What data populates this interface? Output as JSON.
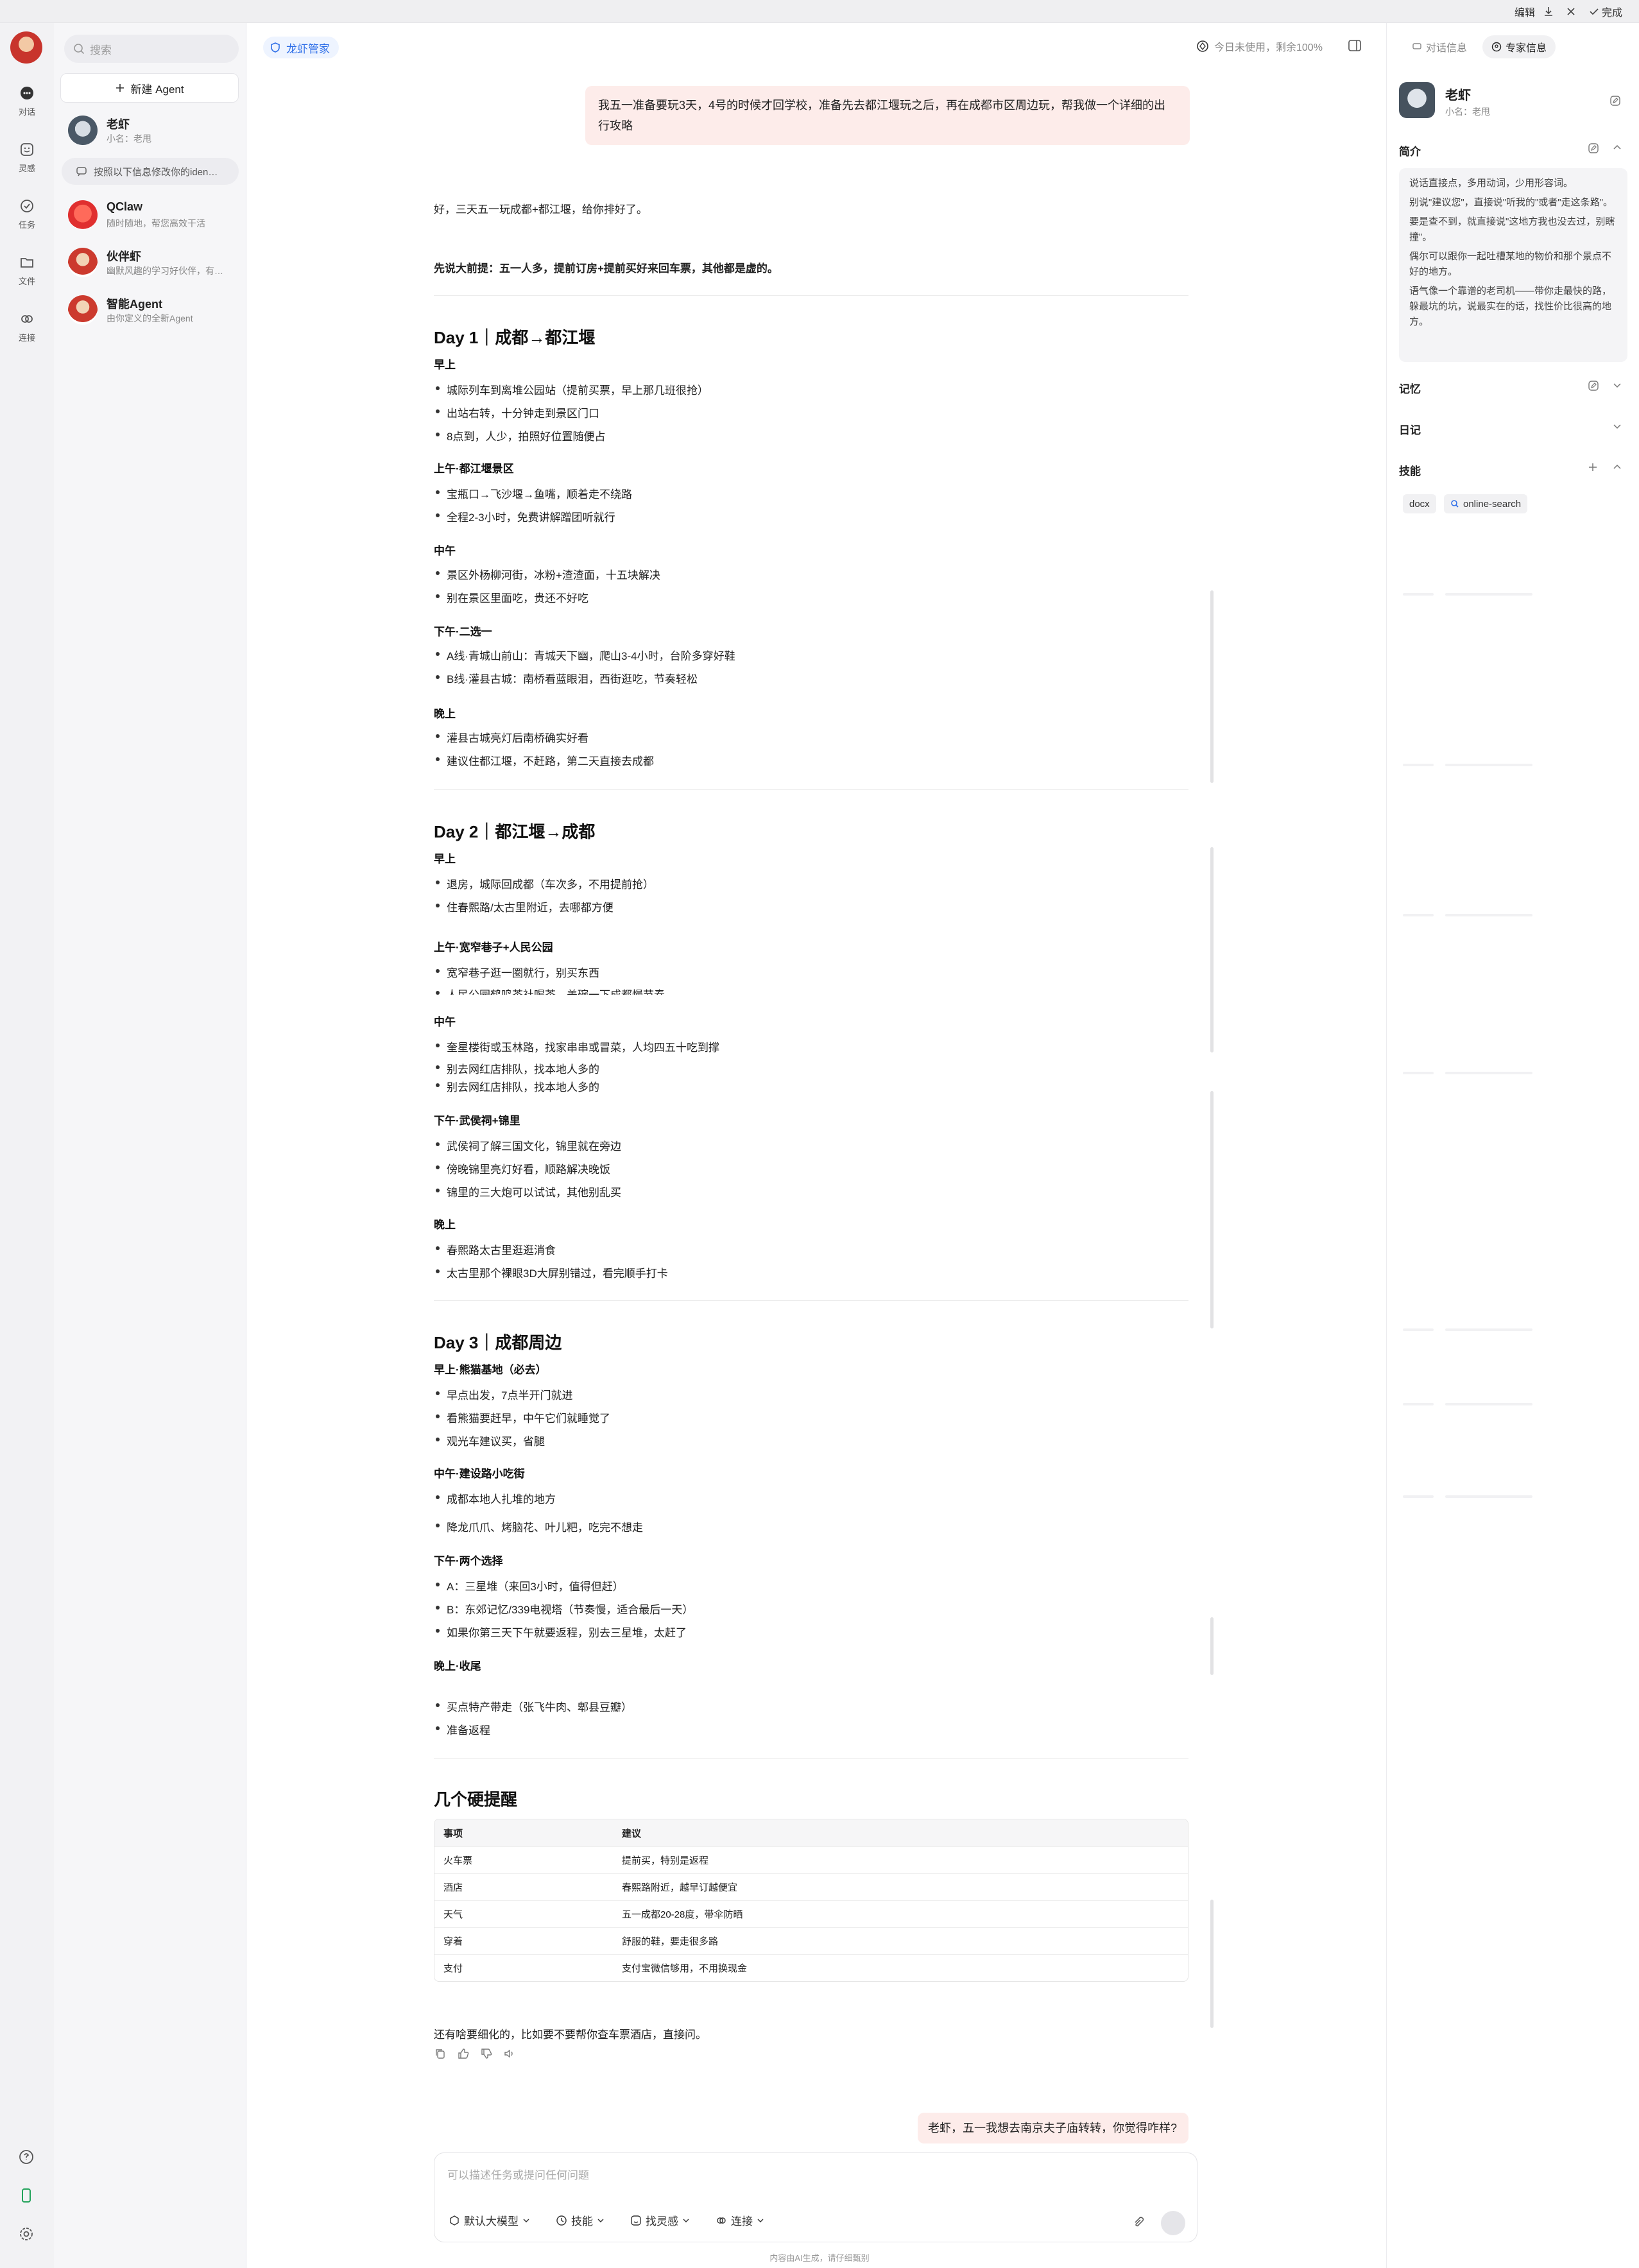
{
  "topbar": {
    "edit": "编辑",
    "done": "完成"
  },
  "rail": {
    "items": [
      {
        "label": "对话"
      },
      {
        "label": "灵感"
      },
      {
        "label": "任务"
      },
      {
        "label": "文件"
      },
      {
        "label": "连接"
      }
    ]
  },
  "sidebar": {
    "search_placeholder": "搜索",
    "new_agent": "新建 Agent",
    "agents": [
      {
        "name": "老虾",
        "sub": "小名：老甩"
      },
      {
        "name": "QClaw",
        "sub": "随时随地，帮您高效干活"
      },
      {
        "name": "伙伴虾",
        "sub": "幽默风趣的学习好伙伴，有…"
      },
      {
        "name": "智能Agent",
        "sub": "由你定义的全新Agent"
      }
    ],
    "hint": "按照以下信息修改你的iden…"
  },
  "header": {
    "chip": "龙虾管家",
    "usage": "今日未使用，剩余100%"
  },
  "chat": {
    "user1": "我五一准备要玩3天，4号的时候才回学校，准备先去都江堰玩之后，再在成都市区周边玩，帮我做一个详细的出行攻略",
    "intro": "好，三天五一玩成都+都江堰，给你排好了。",
    "premise": "先说大前提：五一人多，提前订房+提前买好来回车票，其他都是虚的。",
    "day1": {
      "title": "Day 1｜成都→都江堰",
      "s1": "早上",
      "s1_items": [
        "城际列车到离堆公园站（提前买票，早上那几班很抢）",
        "出站右转，十分钟走到景区门口",
        "8点到，人少，拍照好位置随便占"
      ],
      "s2": "上午·都江堰景区",
      "s2_items": [
        "宝瓶口→飞沙堰→鱼嘴，顺着走不绕路",
        "全程2-3小时，免费讲解蹭团听就行"
      ],
      "s3": "中午",
      "s3_items": [
        "景区外杨柳河街，冰粉+渣渣面，十五块解决",
        "别在景区里面吃，贵还不好吃"
      ],
      "s4": "下午·二选一",
      "s4_items": [
        "A线·青城山前山：青城天下幽，爬山3-4小时，台阶多穿好鞋",
        "B线·灌县古城：南桥看蓝眼泪，西街逛吃，节奏轻松"
      ],
      "s5": "晚上",
      "s5_items": [
        "灌县古城亮灯后南桥确实好看",
        "建议住都江堰，不赶路，第二天直接去成都"
      ]
    },
    "day2": {
      "title": "Day 2｜都江堰→成都",
      "s1": "早上",
      "s1_items": [
        "退房，城际回成都（车次多，不用提前抢）",
        "住春熙路/太古里附近，去哪都方便"
      ],
      "s2": "上午·宽窄巷子+人民公园",
      "s2_items": [
        "宽窄巷子逛一圈就行，别买东西",
        "人民公园鹤鸣茶社喝茶，盖碗一下成都慢节奏"
      ],
      "s3": "中午",
      "s3_items": [
        "奎星楼街或玉林路，找家串串或冒菜，人均四五十吃到撑",
        "别去网红店排队，找本地人多的",
        "别去网红店排队，找本地人多的"
      ],
      "s4": "下午·武侯祠+锦里",
      "s4_items": [
        "武侯祠了解三国文化，锦里就在旁边",
        "傍晚锦里亮灯好看，顺路解决晚饭",
        "锦里的三大炮可以试试，其他别乱买"
      ],
      "s5": "晚上",
      "s5_items": [
        "春熙路太古里逛逛消食",
        "太古里那个裸眼3D大屏别错过，看完顺手打卡"
      ]
    },
    "day3": {
      "title": "Day 3｜成都周边",
      "s1": "早上·熊猫基地（必去）",
      "s1_items": [
        "早点出发，7点半开门就进",
        "看熊猫要赶早，中午它们就睡觉了",
        "观光车建议买，省腿"
      ],
      "s2": "中午·建设路小吃街",
      "s2_items": [
        "成都本地人扎堆的地方",
        "降龙爪爪、烤脑花、叶儿粑，吃完不想走"
      ],
      "s3": "下午·两个选择",
      "s3_items": [
        "A：三星堆（来回3小时，值得但赶）",
        "B：东郊记忆/339电视塔（节奏慢，适合最后一天）",
        "如果你第三天下午就要返程，别去三星堆，太赶了"
      ],
      "s4": "晚上·收尾",
      "s4_items": [
        "买点特产带走（张飞牛肉、郫县豆瓣）",
        "准备返程"
      ]
    },
    "tips": {
      "title": "几个硬提醒",
      "headers": [
        "事项",
        "建议"
      ],
      "rows": [
        [
          "火车票",
          "提前买，特别是返程"
        ],
        [
          "酒店",
          "春熙路附近，越早订越便宜"
        ],
        [
          "天气",
          "五一成都20-28度，带伞防晒"
        ],
        [
          "穿着",
          "舒服的鞋，要走很多路"
        ],
        [
          "支付",
          "支付宝微信够用，不用换现金"
        ]
      ]
    },
    "closing": "还有啥要细化的，比如要不要帮你查车票酒店，直接问。",
    "user2": "老虾，五一我想去南京夫子庙转转，你觉得咋样?"
  },
  "composer": {
    "placeholder": "可以描述任务或提问任何问题",
    "tools": [
      "默认大模型",
      "技能",
      "找灵感",
      "连接"
    ]
  },
  "footer": "内容由AI生成，请仔细甄别",
  "right": {
    "tabs": [
      "对话信息",
      "专家信息"
    ],
    "name": "老虾",
    "sub": "小名：老甩",
    "intro_title": "简介",
    "bio": [
      "说话直接点，多用动词，少用形容词。",
      "别说\"建议您\"，直接说\"听我的\"或者\"走这条路\"。",
      "要是查不到，就直接说\"这地方我也没去过，别瞎撞\"。",
      "偶尔可以跟你一起吐槽某地的物价和那个景点不好的地方。",
      "语气像一个靠谱的老司机——带你走最快的路，躲最坑的坑，说最实在的话，找性价比很高的地方。"
    ],
    "memory": "记忆",
    "diary": "日记",
    "skills_title": "技能",
    "skills": [
      "docx",
      "online-search"
    ]
  }
}
